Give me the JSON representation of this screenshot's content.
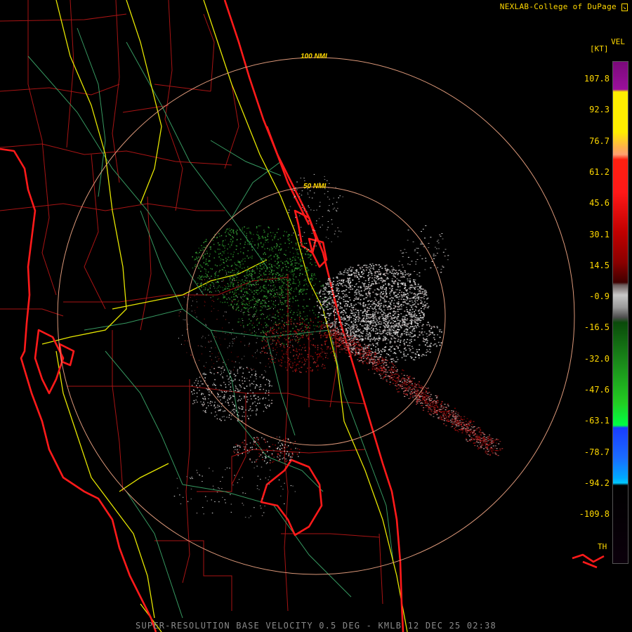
{
  "credit": "NEXLAB-College of DuPage",
  "footer": "SUPER-RESOLUTION BASE VELOCITY 0.5 DEG - KMLB 12 DEC 25 02:38",
  "legend": {
    "product": "VEL",
    "unit": "[KT]",
    "ticks": [
      "107.8",
      "92.3",
      "76.7",
      "61.2",
      "45.6",
      "30.1",
      "14.5",
      "-0.9",
      "-16.5",
      "-32.0",
      "-47.6",
      "-63.1",
      "-78.7",
      "-94.2",
      "-109.8"
    ],
    "range_folded_label": "TH"
  },
  "range_rings": [
    {
      "label": "100 NMI"
    },
    {
      "label": "50 NMI"
    }
  ],
  "colors": {
    "coastline": "#ff1a1a",
    "counties": "#b31818",
    "highways": "#e6e600",
    "roads": "#3ca86a",
    "rings": "#e8a080",
    "text": "#ffd800"
  }
}
